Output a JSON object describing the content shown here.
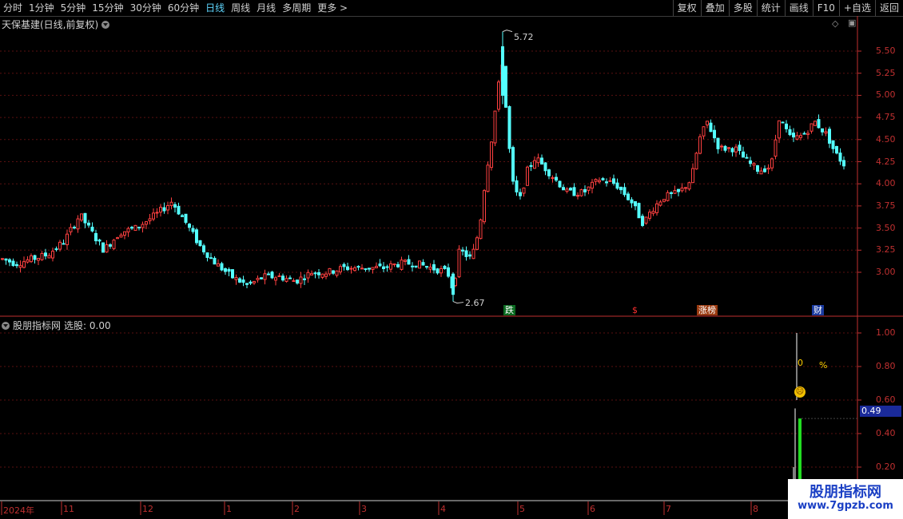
{
  "toolbar": {
    "periods": [
      "分时",
      "1分钟",
      "5分钟",
      "15分钟",
      "30分钟",
      "60分钟",
      "日线",
      "周线",
      "月线",
      "多周期",
      "更多 >"
    ],
    "active_period": "日线",
    "right_buttons": [
      "复权",
      "叠加",
      "多股",
      "统计",
      "画线",
      "F10",
      "+自选",
      "返回"
    ]
  },
  "main_panel": {
    "title": "天保基建(日线,前复权)",
    "y_ticks": [
      "5.50",
      "5.25",
      "5.00",
      "4.75",
      "4.50",
      "4.25",
      "4.00",
      "3.75",
      "3.50",
      "3.25",
      "3.00"
    ],
    "high_label": "5.72",
    "low_label": "2.67",
    "events": [
      "跌",
      "$",
      "涨榜",
      "财"
    ]
  },
  "sub_panel": {
    "title": "股朋指标网",
    "label": "选股: 0.00",
    "y_ticks": [
      "1.00",
      "0.80",
      "0.60",
      "0.40",
      "0.20"
    ],
    "current_value": "0.49",
    "annot_o": "0",
    "annot_pct": "%"
  },
  "x_axis": {
    "labels": [
      "2024年",
      "11",
      "12",
      "1",
      "2",
      "3",
      "4",
      "5",
      "6",
      "7",
      "8"
    ]
  },
  "watermark": {
    "line1": "股朋指标网",
    "line2": "www.7gpzb.com"
  },
  "colors": {
    "up": "#ff4040",
    "down": "#54ffff",
    "grid": "#5a1010",
    "axis": "#c03030"
  }
}
